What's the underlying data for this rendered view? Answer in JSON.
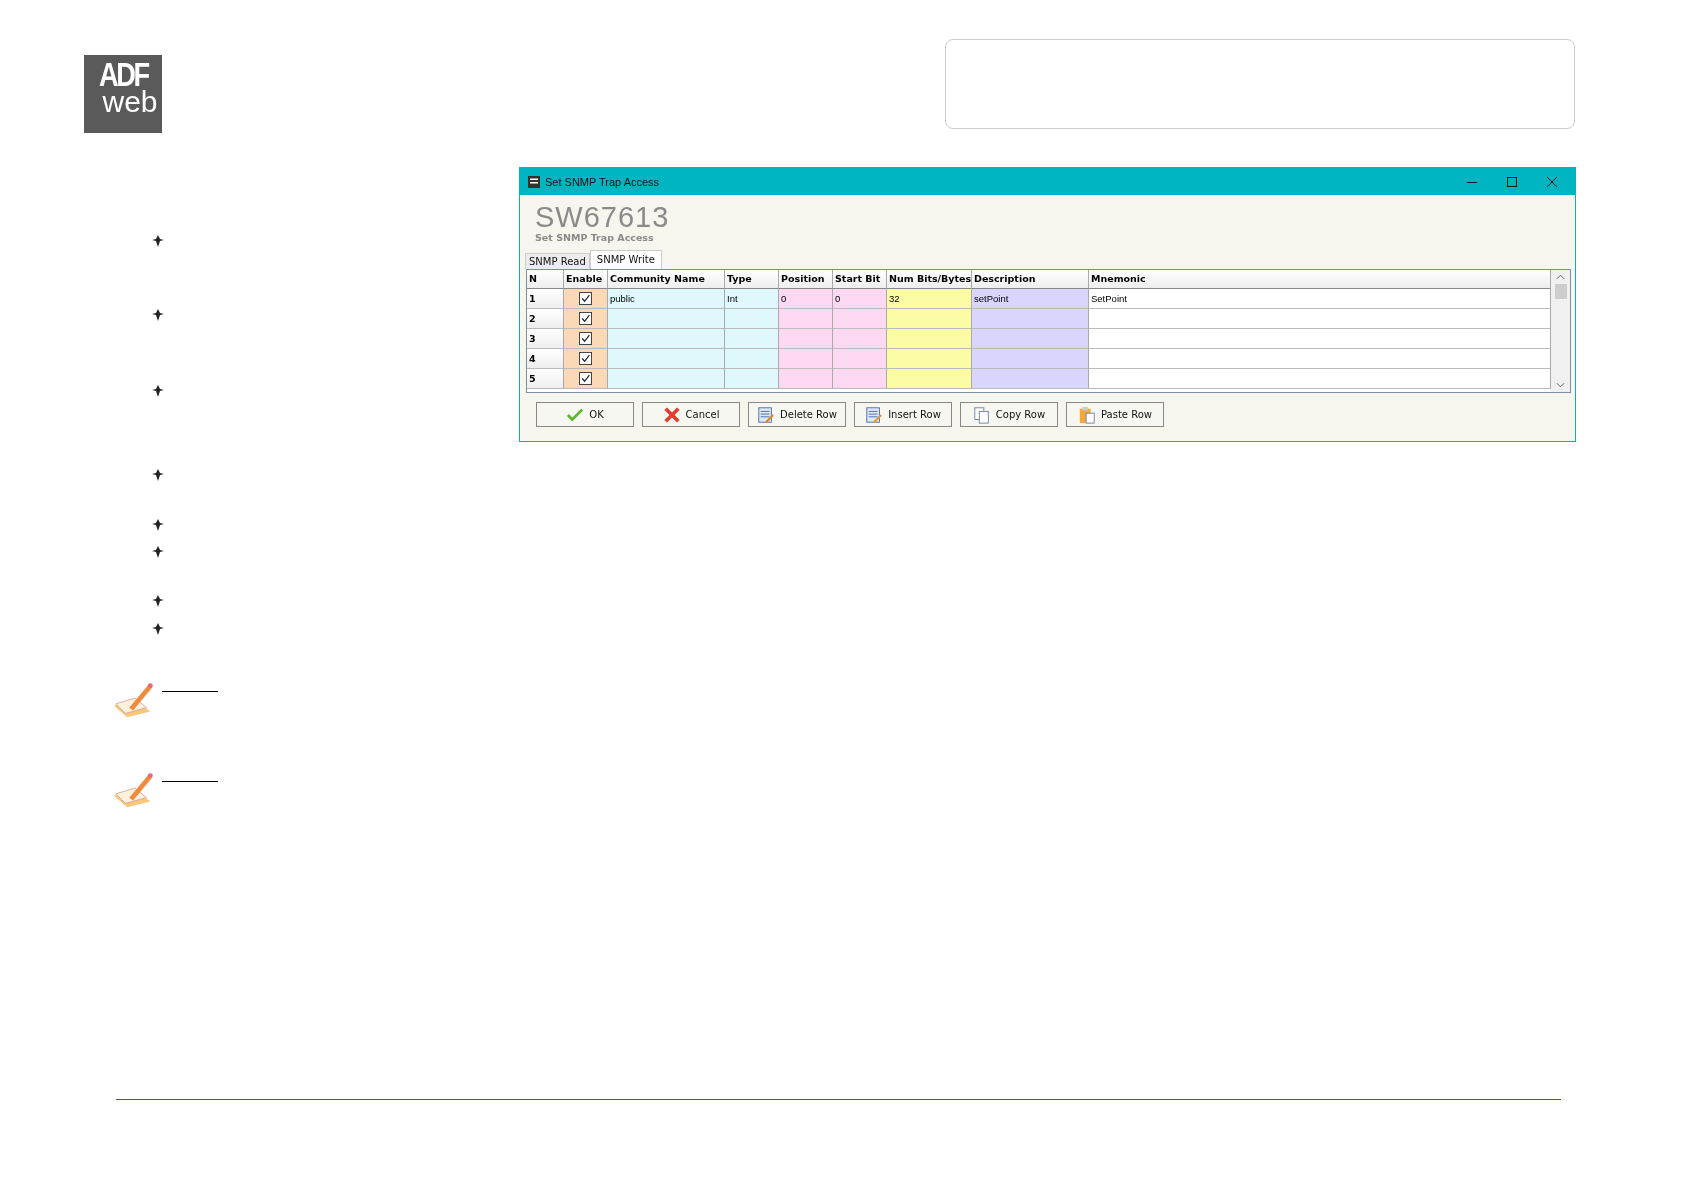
{
  "logo": {
    "line_1": "ADF",
    "line_2": "web"
  },
  "window": {
    "title": "Set SNMP Trap Access",
    "heading": "SW67613",
    "subheading": "Set SNMP Trap Access"
  },
  "tabs": [
    {
      "label": "SNMP Read",
      "selected": false
    },
    {
      "label": "SNMP Write",
      "selected": true
    }
  ],
  "table": {
    "columns": [
      "N",
      "Enable",
      "Community Name",
      "Type",
      "Position",
      "Start Bit",
      "Num Bits/Bytes",
      "Description",
      "Mnemonic"
    ],
    "rows": [
      {
        "enabled": true,
        "cells": [
          "1",
          "",
          "public",
          "Int",
          "0",
          "0",
          "32",
          "setPoint",
          "SetPoint"
        ]
      },
      {
        "enabled": true,
        "cells": [
          "2",
          "",
          "",
          "",
          "",
          "",
          "",
          "",
          ""
        ]
      },
      {
        "enabled": true,
        "cells": [
          "3",
          "",
          "",
          "",
          "",
          "",
          "",
          "",
          ""
        ]
      },
      {
        "enabled": true,
        "cells": [
          "4",
          "",
          "",
          "",
          "",
          "",
          "",
          "",
          ""
        ]
      },
      {
        "enabled": true,
        "cells": [
          "5",
          "",
          "",
          "",
          "",
          "",
          "",
          "",
          ""
        ]
      }
    ]
  },
  "buttons": [
    {
      "label": "OK",
      "kind": "ok"
    },
    {
      "label": "Cancel",
      "kind": "cancel"
    },
    {
      "label": "Delete Row",
      "kind": "delete"
    },
    {
      "label": "Insert Row",
      "kind": "insert"
    },
    {
      "label": "Copy Row",
      "kind": "copy"
    },
    {
      "label": "Paste Row",
      "kind": "paste"
    }
  ]
}
